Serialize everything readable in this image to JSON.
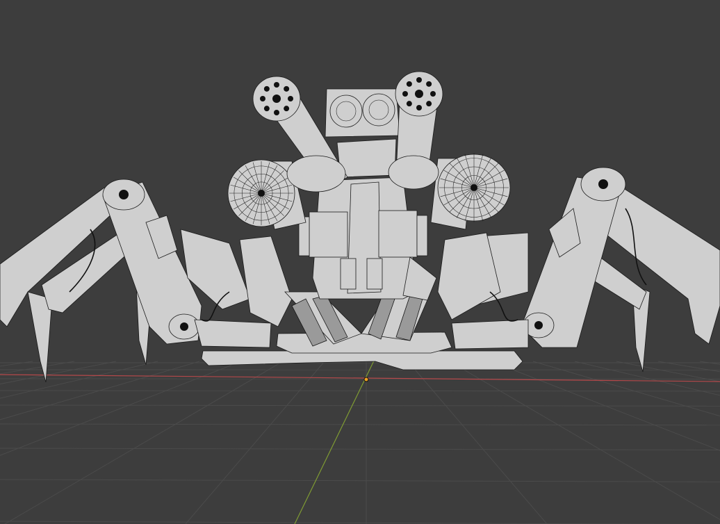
{
  "viewport": {
    "background_color": "#3d3d3d",
    "grid_color": "#4b4b4b",
    "x_axis_color": "#b5484a",
    "y_axis_color": "#7f9b33",
    "origin_color": "#f0a020",
    "mode": "wireframe",
    "model": "mechanical-spider-robot"
  }
}
